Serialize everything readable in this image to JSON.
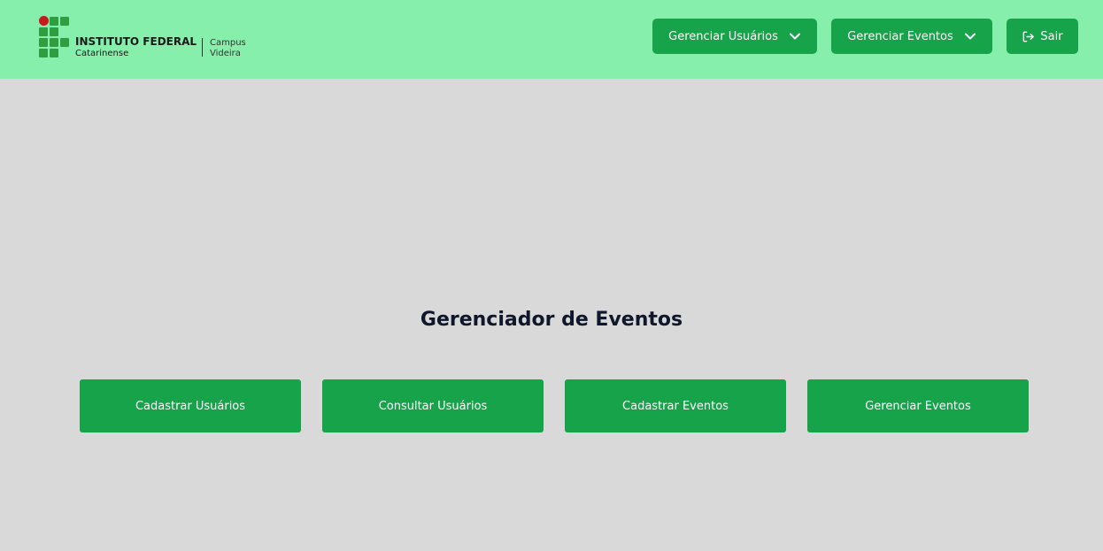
{
  "header": {
    "logo": {
      "title": "INSTITUTO FEDERAL",
      "subtitle": "Catarinense",
      "campus_line1": "Campus",
      "campus_line2": "Videira"
    },
    "nav": {
      "manage_users_label": "Gerenciar Usuários",
      "manage_events_label": "Gerenciar Eventos",
      "logout_label": "Sair"
    }
  },
  "main": {
    "title": "Gerenciador de Eventos",
    "actions": [
      {
        "label": "Cadastrar Usuários"
      },
      {
        "label": "Consultar Usuários"
      },
      {
        "label": "Cadastrar Eventos"
      },
      {
        "label": "Gerenciar Eventos"
      }
    ]
  },
  "colors": {
    "header_bg": "#86efac",
    "page_bg": "#d9d9d9",
    "button": "#16a34a",
    "logo_green": "#2f9e41",
    "logo_red": "#c8191e"
  },
  "icons": {
    "dropdown": "chevron-down-icon",
    "logout": "logout-icon"
  }
}
